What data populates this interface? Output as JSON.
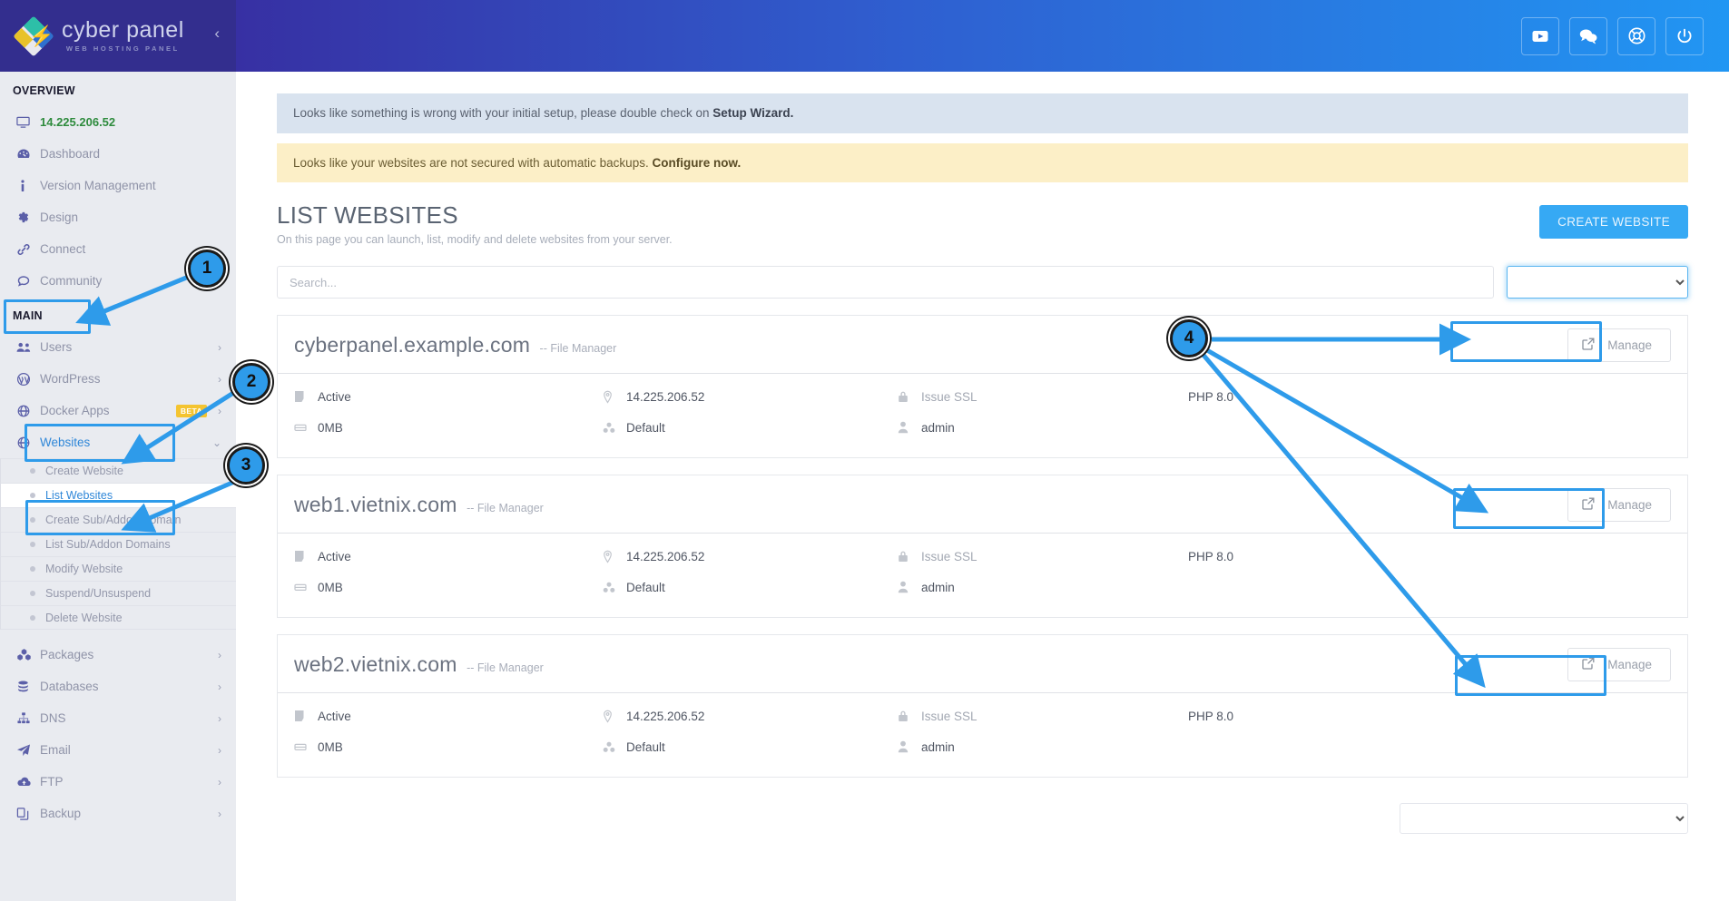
{
  "brand": {
    "title": "cyber panel",
    "subtitle": "WEB HOSTING PANEL",
    "collapse_glyph": "‹"
  },
  "header": {
    "buttons": [
      {
        "name": "youtube-icon",
        "label": "YouTube"
      },
      {
        "name": "chat-icon",
        "label": "Chat"
      },
      {
        "name": "lifebuoy-icon",
        "label": "Support"
      },
      {
        "name": "power-icon",
        "label": "Sign out"
      }
    ]
  },
  "sidebar": {
    "overview_label": "OVERVIEW",
    "main_label": "MAIN",
    "overview_items": [
      {
        "label": "14.225.206.52",
        "icon": "monitor-icon",
        "style": "green",
        "caret": ""
      },
      {
        "label": "Dashboard",
        "icon": "dashboard-icon",
        "style": "",
        "caret": ""
      },
      {
        "label": "Version Management",
        "icon": "info-icon",
        "style": "",
        "caret": ""
      },
      {
        "label": "Design",
        "icon": "gear-icon",
        "style": "",
        "caret": ""
      },
      {
        "label": "Connect",
        "icon": "link-icon",
        "style": "",
        "caret": ""
      },
      {
        "label": "Community",
        "icon": "comment-icon",
        "style": "",
        "caret": ""
      }
    ],
    "main_items": [
      {
        "label": "Users",
        "icon": "users-icon",
        "caret": "›",
        "badge": ""
      },
      {
        "label": "WordPress",
        "icon": "wordpress-icon",
        "caret": "›",
        "badge": ""
      },
      {
        "label": "Docker Apps",
        "icon": "globe-icon",
        "caret": "›",
        "badge": "BETA"
      },
      {
        "label": "Websites",
        "icon": "globe-icon",
        "caret": "⌄",
        "badge": "",
        "active": true
      }
    ],
    "websites_sub_items": [
      {
        "label": "Create Website",
        "selected": false
      },
      {
        "label": "List Websites",
        "selected": true
      },
      {
        "label": "Create Sub/Addon Domain",
        "selected": false
      },
      {
        "label": "List Sub/Addon Domains",
        "selected": false
      },
      {
        "label": "Modify Website",
        "selected": false
      },
      {
        "label": "Suspend/Unsuspend",
        "selected": false
      },
      {
        "label": "Delete Website",
        "selected": false
      }
    ],
    "lower_items": [
      {
        "label": "Packages",
        "icon": "packages-icon",
        "caret": "›"
      },
      {
        "label": "Databases",
        "icon": "database-icon",
        "caret": "›"
      },
      {
        "label": "DNS",
        "icon": "sitemap-icon",
        "caret": "›"
      },
      {
        "label": "Email",
        "icon": "paper-plane-icon",
        "caret": "›"
      },
      {
        "label": "FTP",
        "icon": "cloud-upload-icon",
        "caret": "›"
      },
      {
        "label": "Backup",
        "icon": "copy-icon",
        "caret": "›"
      }
    ]
  },
  "alerts": [
    {
      "type": "info",
      "text": "Looks like something is wrong with your initial setup, please double check on ",
      "link": "Setup Wizard."
    },
    {
      "type": "warning",
      "text": "Looks like your websites are not secured with automatic backups. ",
      "link": "Configure now."
    }
  ],
  "page": {
    "title": "LIST WEBSITES",
    "subtitle": "On this page you can launch, list, modify and delete websites from your server.",
    "create_button": "CREATE WEBSITE"
  },
  "filters": {
    "search_placeholder": "Search...",
    "top_select_value": "",
    "bottom_select_value": ""
  },
  "websites": [
    {
      "domain": "cyberpanel.example.com",
      "file_manager_label": "-- File Manager",
      "manage_label": "Manage",
      "status": "Active",
      "ip": "14.225.206.52",
      "ssl": "Issue SSL",
      "php": "PHP 8.0",
      "disk": "0MB",
      "package": "Default",
      "owner": "admin"
    },
    {
      "domain": "web1.vietnix.com",
      "file_manager_label": "-- File Manager",
      "manage_label": "Manage",
      "status": "Active",
      "ip": "14.225.206.52",
      "ssl": "Issue SSL",
      "php": "PHP 8.0",
      "disk": "0MB",
      "package": "Default",
      "owner": "admin"
    },
    {
      "domain": "web2.vietnix.com",
      "file_manager_label": "-- File Manager",
      "manage_label": "Manage",
      "status": "Active",
      "ip": "14.225.206.52",
      "ssl": "Issue SSL",
      "php": "PHP 8.0",
      "disk": "0MB",
      "package": "Default",
      "owner": "admin"
    }
  ],
  "annotations": {
    "accent_color": "#2e9bea",
    "callouts": [
      {
        "number": "1"
      },
      {
        "number": "2"
      },
      {
        "number": "3"
      },
      {
        "number": "4"
      }
    ]
  }
}
